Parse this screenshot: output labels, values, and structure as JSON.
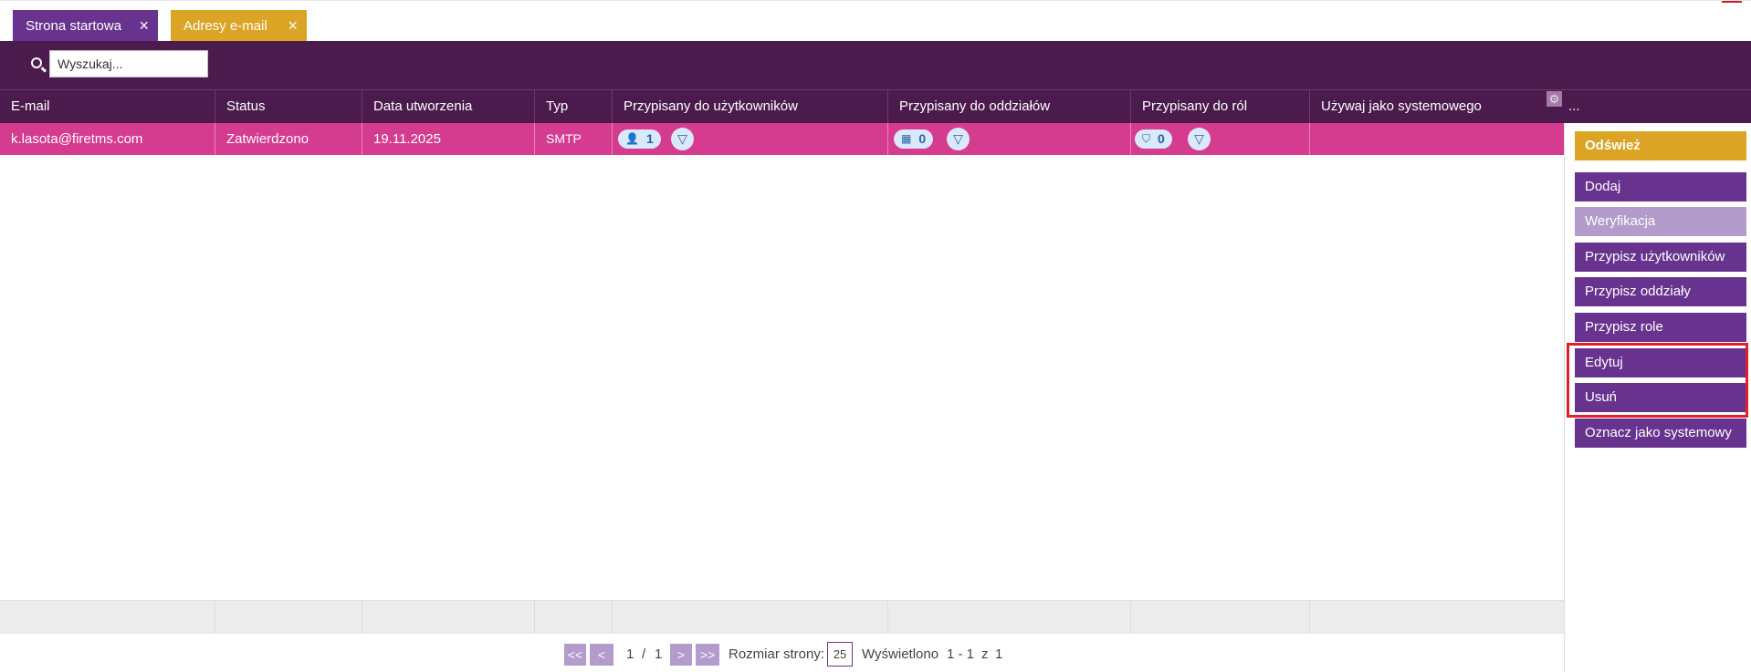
{
  "tabs": [
    {
      "label": "Strona startowa",
      "close": "×",
      "color": "#68338f"
    },
    {
      "label": "Adresy e-mail",
      "close": "×",
      "color": "#dca425"
    }
  ],
  "search": {
    "placeholder": "Wyszukaj...",
    "value": ""
  },
  "table": {
    "columns": [
      "E-mail",
      "Status",
      "Data utworzenia",
      "Typ",
      "Przypisany do użytkowników",
      "Przypisany do oddziałów",
      "Przypisany do ról",
      "Używaj jako systemowego",
      "..."
    ],
    "rows": [
      {
        "email": "k.lasota@firetms.com",
        "status": "Zatwierdzono",
        "created": "19.11.2025",
        "type": "SMTP",
        "users": "1",
        "branches": "0",
        "roles": "0",
        "system": ""
      }
    ]
  },
  "actions": {
    "refresh": "Odśwież",
    "add": "Dodaj",
    "verify": "Weryfikacja",
    "assign_users": "Przypisz użytkowników",
    "assign_branches": "Przypisz oddziały",
    "assign_roles": "Przypisz role",
    "edit": "Edytuj",
    "delete": "Usuń",
    "mark_system": "Oznacz jako systemowy"
  },
  "pager": {
    "first": "<<",
    "prev": "<",
    "page": "1",
    "sep": "/",
    "pages": "1",
    "next": ">",
    "last": ">>",
    "size_label": "Rozmiar strony:",
    "size": "25",
    "shown_label": "Wyświetlono",
    "range": "1 - 1",
    "of": "z",
    "total": "1"
  },
  "colors": {
    "header": "#4b1b4d",
    "selected_row": "#d53b8f",
    "accent_purple": "#68338f",
    "accent_yellow": "#dca425",
    "highlight": "#e0202a"
  }
}
